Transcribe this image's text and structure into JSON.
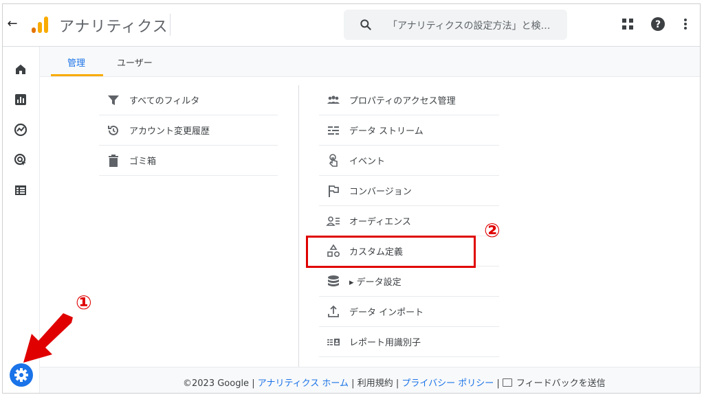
{
  "header": {
    "back_icon": "arrow-left-icon",
    "app_title": "アナリティクス",
    "search_placeholder": "「アナリティクスの設定方法」と検…",
    "icons": [
      "apps-grid-icon",
      "help-icon",
      "more-vert-icon"
    ]
  },
  "rail": {
    "items": [
      "home-icon",
      "reports-icon",
      "explore-icon",
      "advertising-icon",
      "configure-icon"
    ]
  },
  "tabs": [
    {
      "label": "管理",
      "active": true
    },
    {
      "label": "ユーザー",
      "active": false
    }
  ],
  "left_column": {
    "items": [
      {
        "label": "すべてのフィルタ",
        "icon": "filter-icon"
      },
      {
        "label": "アカウント変更履歴",
        "icon": "history-icon"
      },
      {
        "label": "ゴミ箱",
        "icon": "trash-icon"
      }
    ]
  },
  "right_column": {
    "items": [
      {
        "label": "プロパティのアクセス管理",
        "icon": "people-icon"
      },
      {
        "label": "データ ストリーム",
        "icon": "data-stream-icon"
      },
      {
        "label": "イベント",
        "icon": "touch-icon"
      },
      {
        "label": "コンバージョン",
        "icon": "flag-icon"
      },
      {
        "label": "オーディエンス",
        "icon": "audience-icon"
      },
      {
        "label": "カスタム定義",
        "icon": "shapes-icon"
      },
      {
        "label": "▸ データ設定",
        "icon": "database-icon"
      },
      {
        "label": "データ インポート",
        "icon": "upload-icon"
      },
      {
        "label": "レポート用識別子",
        "icon": "identifier-icon"
      }
    ]
  },
  "footer": {
    "copyright": "©2023 Google",
    "sep": " | ",
    "home_link": "アナリティクス ホーム",
    "terms_link": "利用規約",
    "privacy_link": "プライバシー ポリシー",
    "feedback": "フィードバックを送信",
    "feedback_icon": "feedback-icon"
  },
  "annotations": {
    "step1": "①",
    "step2": "②",
    "color": "#e00000"
  },
  "colors": {
    "accent": "#1a73e8",
    "tab_underline": "#f9ab00"
  }
}
